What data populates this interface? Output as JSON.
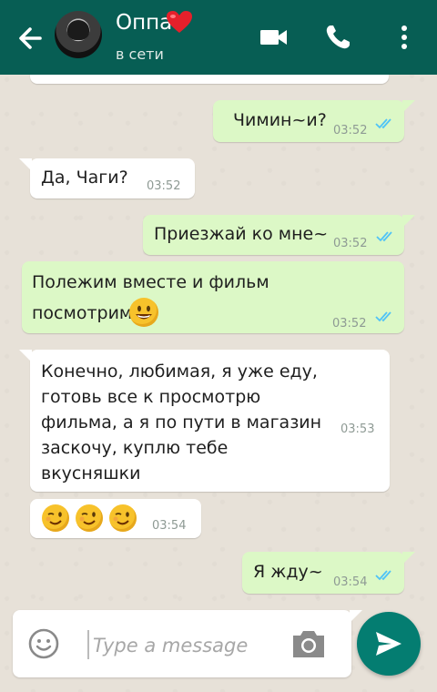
{
  "header": {
    "contact_name": "Оппа",
    "status": "в сети"
  },
  "messages": [
    {
      "text": "Чимин~и?",
      "time": "03:52",
      "direction": "out"
    },
    {
      "text": "Да, Чаги?",
      "time": "03:52",
      "direction": "in"
    },
    {
      "text": "Приезжай ко мне~",
      "time": "03:52",
      "direction": "out"
    },
    {
      "line1": "Полежим вместе и фильм",
      "line2": "посмотрим",
      "time": "03:52",
      "direction": "out"
    },
    {
      "lines": [
        "Конечно, любимая, я уже еду,",
        "готовь все к просмотрю",
        "фильма, а я по пути в магазин",
        "заскочу, куплю тебе",
        "вкусняшки"
      ],
      "time": "03:53",
      "direction": "in"
    },
    {
      "text": "",
      "time": "03:54",
      "direction": "in",
      "emoji_count": 3
    },
    {
      "text": "Я жду~",
      "time": "03:54",
      "direction": "out"
    }
  ],
  "input": {
    "placeholder": "Type a message"
  },
  "colors": {
    "header": "#075e54",
    "outgoing_bubble": "#dcf8c6",
    "incoming_bubble": "#ffffff",
    "send_button": "#047d71",
    "read_ticks": "#4fc3f7"
  }
}
